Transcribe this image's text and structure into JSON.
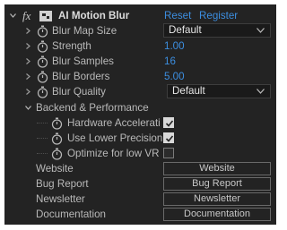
{
  "effect": {
    "fx": "fx",
    "name": "AI Motion Blur",
    "reset": "Reset",
    "register": "Register"
  },
  "params": [
    {
      "label": "Blur Map Size",
      "type": "dropdown",
      "value": "Default"
    },
    {
      "label": "Strength",
      "type": "number",
      "value": "1.00"
    },
    {
      "label": "Blur Samples",
      "type": "number",
      "value": "16"
    },
    {
      "label": "Blur Borders",
      "type": "number",
      "value": "5.00"
    },
    {
      "label": "Blur Quality",
      "type": "dropdown",
      "value": "Default"
    }
  ],
  "group": {
    "label": "Backend & Performance",
    "items": [
      {
        "label": "Hardware Accelerati",
        "checked": true
      },
      {
        "label": "Use Lower Precision",
        "checked": true
      },
      {
        "label": "Optimize for low VR",
        "checked": false
      }
    ]
  },
  "links": [
    {
      "label": "Website",
      "button": "Website"
    },
    {
      "label": "Bug Report",
      "button": "Bug Report"
    },
    {
      "label": "Newsletter",
      "button": "Newsletter"
    },
    {
      "label": "Documentation",
      "button": "Documentation"
    }
  ],
  "icons": {
    "expand": "chevron-down-icon",
    "collapsed": "chevron-right-icon",
    "keyframe": "stopwatch-icon",
    "checkbox": "checkmark-icon"
  },
  "colors": {
    "panel": "#232323",
    "accent": "#3c8ee0",
    "text": "#b9b9b9"
  }
}
